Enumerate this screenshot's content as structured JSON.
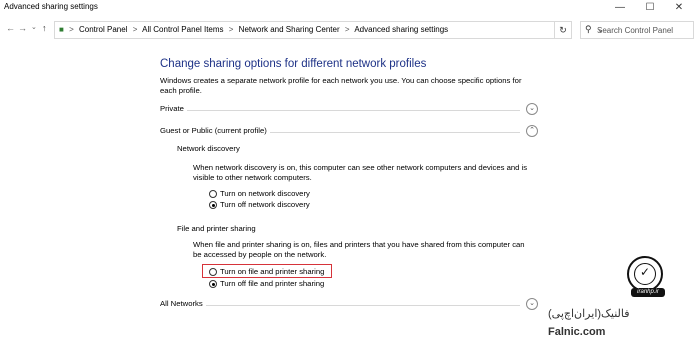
{
  "window": {
    "title": "Advanced sharing settings",
    "minimize_glyph": "—",
    "maximize_glyph": "☐",
    "close_glyph": "✕"
  },
  "nav": {
    "back_glyph": "←",
    "forward_glyph": "→",
    "recent_glyph": "⌄",
    "up_glyph": "↑"
  },
  "address": {
    "breadcrumbs": [
      "Control Panel",
      "All Control Panel Items",
      "Network and Sharing Center",
      "Advanced sharing settings"
    ],
    "separator": ">",
    "dropdown_glyph": "⌄",
    "refresh_glyph": "↻"
  },
  "search": {
    "placeholder": "Search Control Panel",
    "icon": "search-icon",
    "glyph": "⚲"
  },
  "page": {
    "title": "Change sharing options for different network profiles",
    "description": "Windows creates a separate network profile for each network you use. You can choose specific options for each profile."
  },
  "profiles": [
    {
      "label": "Private",
      "expanded": false,
      "chevron": "⌄"
    },
    {
      "label": "Guest or Public (current profile)",
      "expanded": true,
      "chevron": "⌃"
    },
    {
      "label": "All Networks",
      "expanded": false,
      "chevron": "⌄"
    }
  ],
  "network_discovery": {
    "heading": "Network discovery",
    "description": "When network discovery is on, this computer can see other network computers and devices and is visible to other network computers.",
    "options": [
      {
        "label": "Turn on network discovery",
        "selected": false
      },
      {
        "label": "Turn off network discovery",
        "selected": true
      }
    ]
  },
  "file_printer_sharing": {
    "heading": "File and printer sharing",
    "description": "When file and printer sharing is on, files and printers that you have shared from this computer can be accessed by people on the network.",
    "options": [
      {
        "label": "Turn on file and printer sharing",
        "selected": false
      },
      {
        "label": "Turn off file and printer sharing",
        "selected": true
      }
    ]
  },
  "watermark": {
    "brand_fa": "فالنیک(ایران‌اچ‌پی)",
    "brand_en": "Falnic.com",
    "badge": "iranhp.ir"
  },
  "colors": {
    "title_blue": "#1e3287",
    "highlight_red": "#d6333a"
  }
}
